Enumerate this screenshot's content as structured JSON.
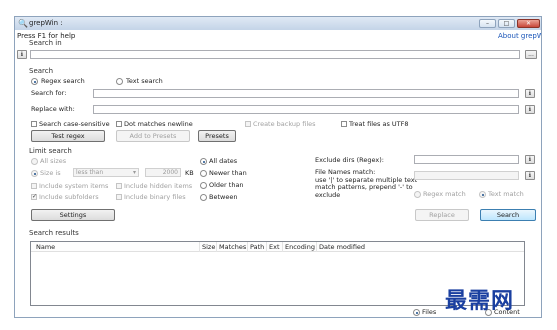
{
  "window": {
    "title": "grepWin :",
    "controls": [
      "–",
      "□",
      "✕"
    ]
  },
  "help_text": "Press F1 for help",
  "about_link": "About grepWin",
  "search_in": {
    "label": "Search in",
    "value": "",
    "history_btn": "ℹ",
    "browse_btn": "..."
  },
  "search": {
    "section_label": "Search",
    "regex_label": "Regex search",
    "text_label": "Text search",
    "search_for_label": "Search for:",
    "replace_with_label": "Replace with:",
    "case_sensitive_label": "Search case-sensitive",
    "dot_newline_label": "Dot matches newline",
    "backup_label": "Create backup files",
    "utf8_label": "Treat files as UTF8",
    "test_regex_btn": "Test regex",
    "add_presets_btn": "Add to Presets",
    "presets_btn": "Presets",
    "info_btn": "ℹ"
  },
  "limit": {
    "section_label": "Limit search",
    "all_sizes": "All sizes",
    "size_is": "Size is",
    "size_op": "less than",
    "size_value": "2000",
    "size_unit": "KB",
    "include_system": "Include system items",
    "include_hidden": "Include hidden items",
    "include_subfolders": "Include subfolders",
    "include_binary": "Include binary files",
    "all_dates": "All dates",
    "newer_than": "Newer than",
    "older_than": "Older than",
    "between": "Between",
    "exclude_dirs_label": "Exclude dirs (Regex):",
    "file_names_label": "File Names match:\nuse '|' to separate multiple text\nmatch patterns, prepend '-' to\nexclude",
    "regex_match": "Regex match",
    "text_match": "Text match",
    "settings_btn": "Settings",
    "replace_btn": "Replace",
    "search_btn": "Search"
  },
  "results": {
    "section_label": "Search results",
    "columns": [
      "Name",
      "Size",
      "Matches",
      "Path",
      "Ext",
      "Encoding",
      "Date modified"
    ],
    "files_label": "Files",
    "content_label": "Content"
  },
  "watermark": "最需网",
  "colors": {
    "link": "#1a55b8",
    "titlebar": "#c4d4e8",
    "watermark": "#1a3fa0"
  }
}
